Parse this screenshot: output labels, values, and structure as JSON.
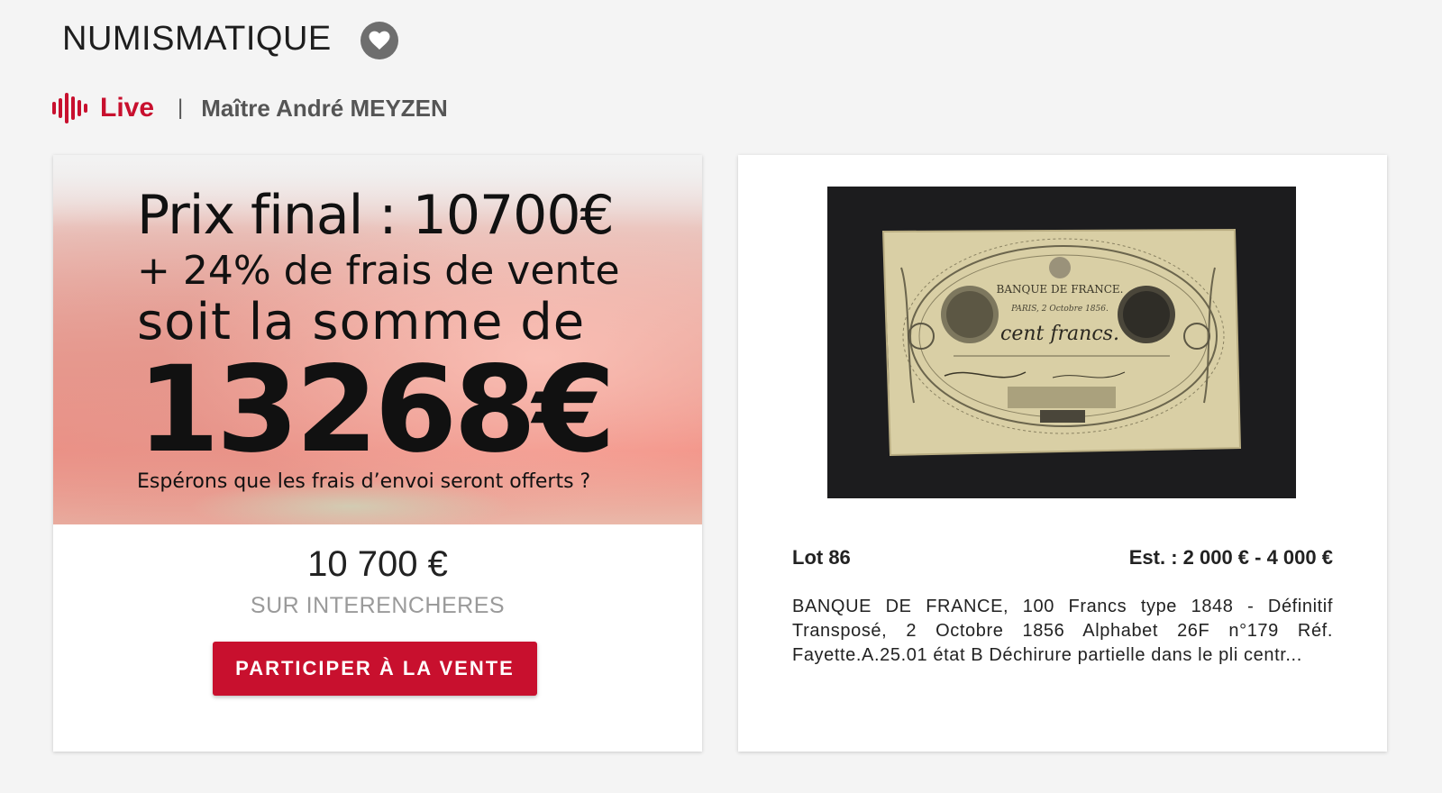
{
  "header": {
    "category": "NUMISMATIQUE",
    "favorite_icon": "heart-icon",
    "live_icon": "live-soundwave-icon",
    "live_label": "Live",
    "separator": "|",
    "auctioneer": "Maître André MEYZEN"
  },
  "result_card": {
    "banner": {
      "line1": "Prix final : 10700€",
      "line2": "+ 24% de frais de vente",
      "line3": "soit la somme de",
      "line4": "1326​8€",
      "line5": "Espérons que les frais d’envoi seront offerts ?"
    },
    "price": "10 700 €",
    "platform": "SUR INTERENCHERES",
    "cta_label": "PARTICIPER À LA VENTE"
  },
  "lot_card": {
    "banknote": {
      "bank": "BANQUE DE FRANCE.",
      "place_date": "PARIS, 2 Octobre 1856.",
      "denomination": "cent francs."
    },
    "lot_number": "Lot 86",
    "estimate": "Est. : 2 000 € - 4 000 €",
    "description": "BANQUE DE FRANCE, 100 Francs type 1848 - Définitif Transposé, 2 Octobre 1856 Alphabet 26F n°179 Réf. Fayette.A.25.01 état B Déchirure partielle dans le pli centr..."
  },
  "colors": {
    "accent": "#c8102e",
    "background": "#f4f4f4",
    "card": "#ffffff",
    "muted": "#9a9a9a"
  }
}
